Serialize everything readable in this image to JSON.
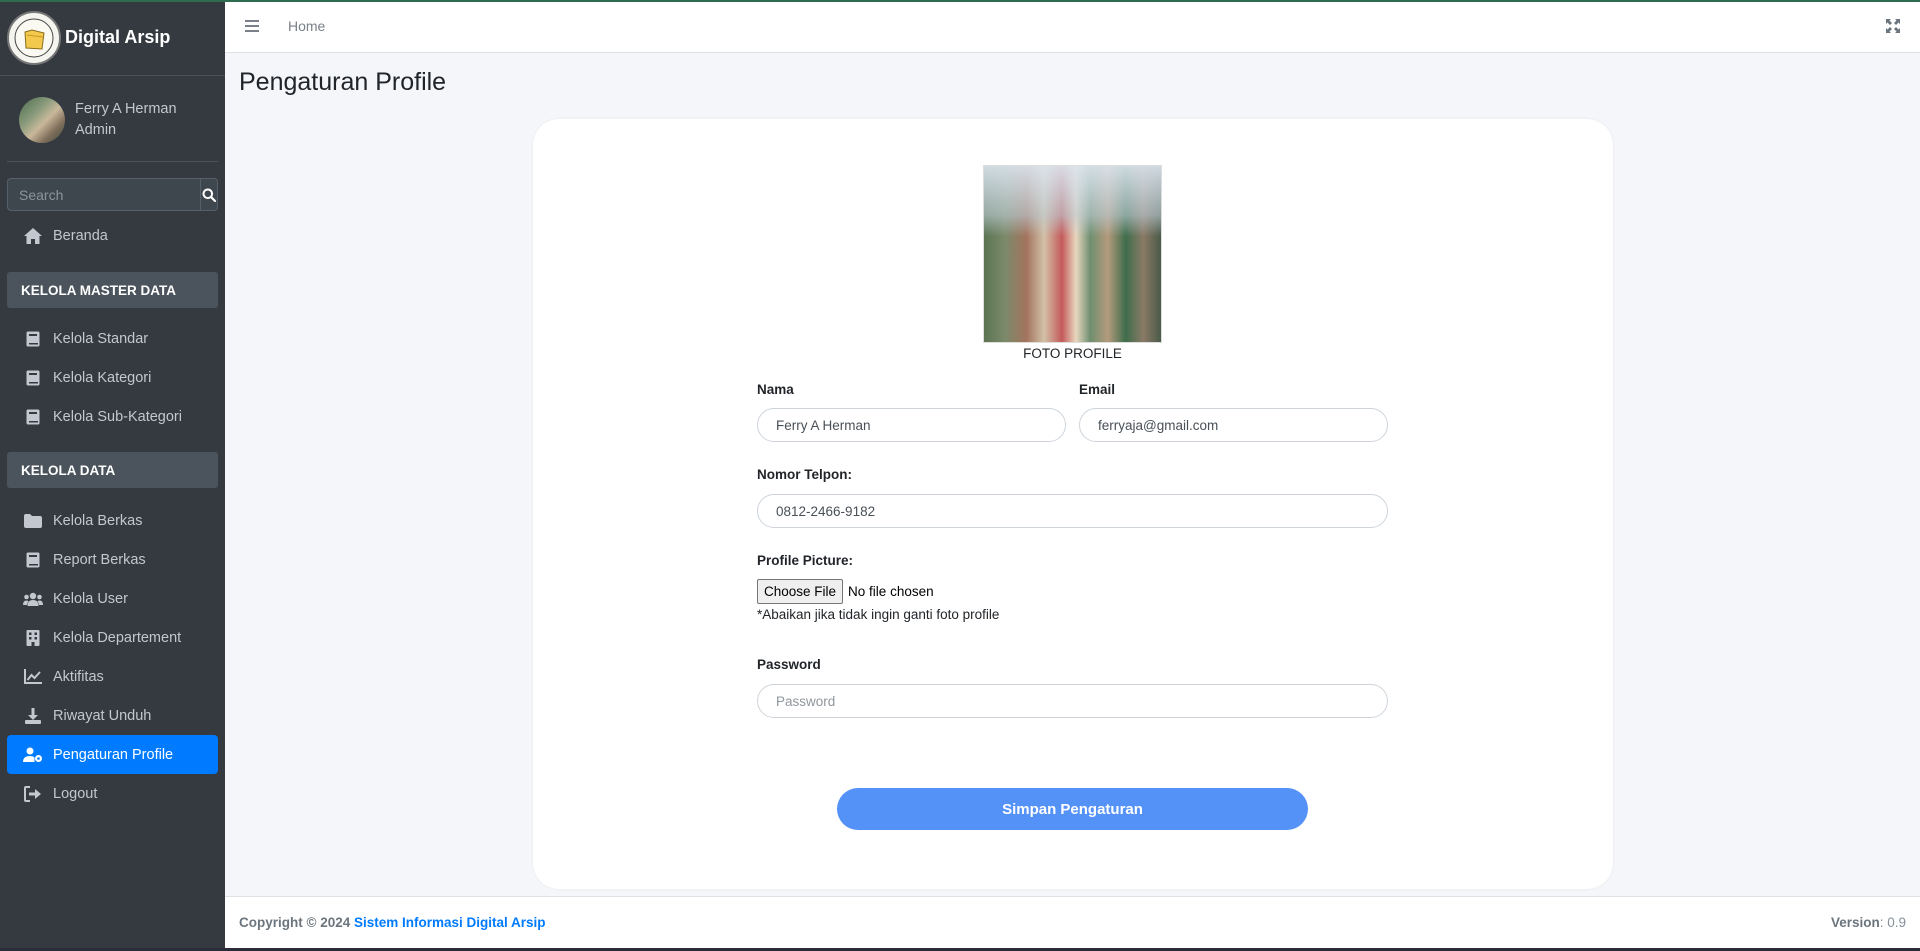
{
  "brand": {
    "title": "Digital Arsip",
    "logo_icon": "folder-logo-icon"
  },
  "user": {
    "name": "Ferry A Herman",
    "role": "Admin"
  },
  "search": {
    "placeholder": "Search"
  },
  "sidebar": {
    "home": "Beranda",
    "header_master": "KELOLA MASTER DATA",
    "master_items": [
      "Kelola Standar",
      "Kelola Kategori",
      "Kelola Sub-Kategori"
    ],
    "header_data": "KELOLA DATA",
    "data_items": [
      "Kelola Berkas",
      "Report Berkas",
      "Kelola User",
      "Kelola Departement",
      "Aktifitas",
      "Riwayat Unduh",
      "Pengaturan Profile",
      "Logout"
    ],
    "active": "Pengaturan Profile"
  },
  "topbar": {
    "home_link": "Home"
  },
  "page": {
    "title": "Pengaturan Profile"
  },
  "form": {
    "photo_caption": "FOTO PROFILE",
    "nama_label": "Nama",
    "nama_value": "Ferry A Herman",
    "email_label": "Email",
    "email_value": "ferryaja@gmail.com",
    "phone_label": "Nomor Telpon:",
    "phone_value": "0812-2466-9182",
    "picture_label": "Profile Picture:",
    "file_button": "Choose File",
    "file_status": "No file chosen",
    "picture_hint": "*Abaikan jika tidak ingin ganti foto profile",
    "password_label": "Password",
    "password_placeholder": "Password",
    "save_button": "Simpan Pengaturan"
  },
  "footer": {
    "copyright": "Copyright © 2024",
    "app_link": "Sistem Informasi Digital Arsip",
    "version_label": "Version",
    "version_value": ": 0.9"
  },
  "colors": {
    "sidebar": "#343a40",
    "active": "#007bff",
    "save": "#5592f8"
  }
}
